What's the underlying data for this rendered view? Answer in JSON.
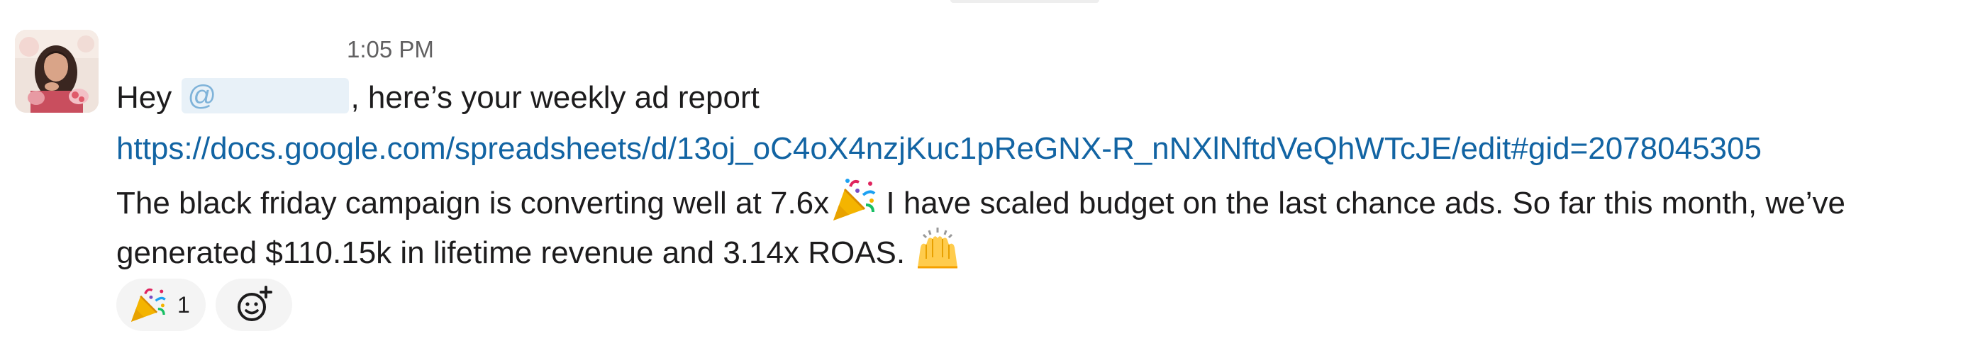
{
  "message": {
    "sender": "",
    "timestamp": "1:05 PM",
    "greeting_prefix": "Hey ",
    "mention_symbol": "@",
    "greeting_suffix": ", here’s your weekly ad report",
    "link": "https://docs.google.com/spreadsheets/d/13oj_oC4oX4nzjKuc1pReGNX-R_nNXlNftdVeQhWTcJE/edit#gid=2078045305",
    "line3_text_a": "The black friday campaign is converting well at 7.6x",
    "line3_text_b": " I have scaled budget on the last chance ads. So far this month, we’ve",
    "line4_text": "generated $110.15k in lifetime revenue and 3.14x ROAS.",
    "emoji_1": "party-popper-icon",
    "emoji_2": "raising-hands-icon"
  },
  "reactions": [
    {
      "emoji": "party-popper-icon",
      "count": "1"
    }
  ],
  "add_reaction_icon": "add-emoji-icon",
  "colors": {
    "link": "#1264a3",
    "mention_bg": "#e8f1f8",
    "text": "#1d1c1d",
    "timestamp": "#616061",
    "pill_bg": "#f4f4f4"
  }
}
